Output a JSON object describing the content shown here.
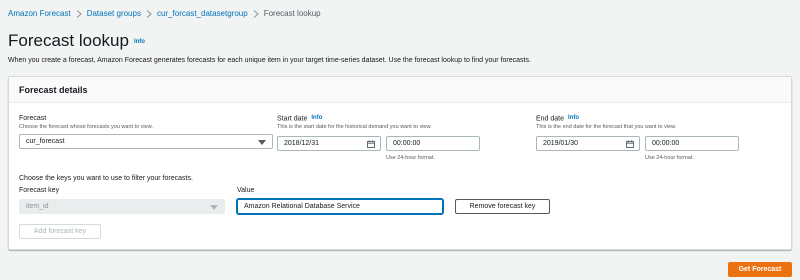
{
  "breadcrumb": {
    "items": [
      "Amazon Forecast",
      "Dataset groups",
      "cur_forcast_datasetgroup"
    ],
    "current": "Forecast lookup"
  },
  "page": {
    "title": "Forecast lookup",
    "info": "Info",
    "description": "When you create a forecast, Amazon Forecast generates forecasts for each unique item in your target time-series dataset. Use the forecast lookup to find your forecasts."
  },
  "panel": {
    "title": "Forecast details",
    "forecast": {
      "label": "Forecast",
      "hint": "Choose the forecast whose forecasts you want to view.",
      "value": "cur_forecast"
    },
    "start_date": {
      "label": "Start date",
      "info": "Info",
      "hint": "This is the start date for the historical demand you want to view.",
      "date": "2018/12/31",
      "time": "00:00:00",
      "time_hint": "Use 24-hour format."
    },
    "end_date": {
      "label": "End date",
      "info": "Info",
      "hint": "This is the end date for the forecast that you want to view.",
      "date": "2019/01/30",
      "time": "00:00:00",
      "time_hint": "Use 24-hour format."
    },
    "filter_intro": "Choose the keys you want to use to filter your forecasts.",
    "forecast_key": {
      "label": "Forecast key",
      "value": "item_id"
    },
    "value_field": {
      "label": "Value",
      "value": "Amazon Relational Database Service"
    },
    "remove_key_label": "Remove forecast key",
    "add_key_label": "Add forecast key"
  },
  "get_forecast_label": "Get Forecast",
  "colors": {
    "link": "#0073bb",
    "primary": "#ec7211",
    "background": "#f2f3f3"
  }
}
